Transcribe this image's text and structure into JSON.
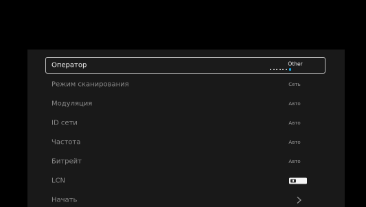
{
  "settings": {
    "rows": [
      {
        "label": "Оператор",
        "value": "Other",
        "selected": true,
        "control": "dots"
      },
      {
        "label": "Режим сканирования",
        "value": "Сеть"
      },
      {
        "label": "Модуляция",
        "value": "Авто"
      },
      {
        "label": "ID сети",
        "value": "Авто"
      },
      {
        "label": "Частота",
        "value": "Авто"
      },
      {
        "label": "Битрейт",
        "value": "Авто"
      },
      {
        "label": "LCN",
        "control": "toggle",
        "toggle_state": "on"
      },
      {
        "label": "Начать",
        "control": "chevron"
      }
    ],
    "operator_pager": {
      "count": 7,
      "active_index": 7
    }
  },
  "colors": {
    "background": "#000000",
    "panel": "#191919",
    "selected_border": "#c4c4c4",
    "accent": "#18a9e6"
  },
  "icons": {
    "toggle": "lcn-toggle-icon",
    "chevron": "chevron-right-icon"
  }
}
